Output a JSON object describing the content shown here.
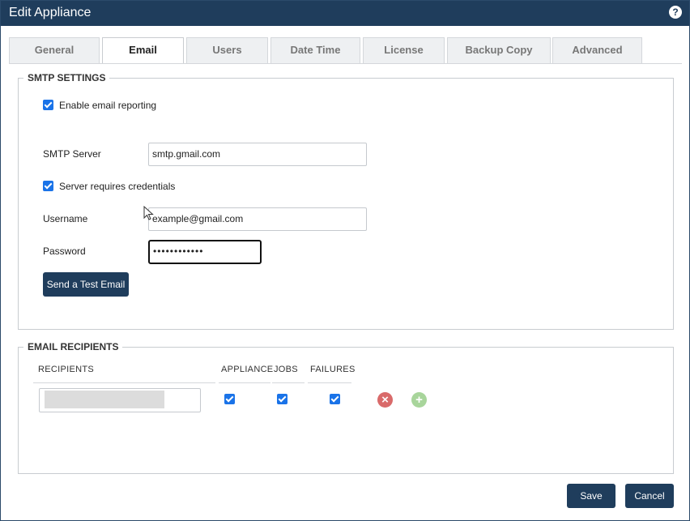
{
  "window": {
    "title": "Edit Appliance",
    "help_glyph": "?"
  },
  "tabs": [
    {
      "label": "General"
    },
    {
      "label": "Email",
      "active": true
    },
    {
      "label": "Users"
    },
    {
      "label": "Date Time"
    },
    {
      "label": "License"
    },
    {
      "label": "Backup Copy"
    },
    {
      "label": "Advanced"
    }
  ],
  "smtp": {
    "legend": "SMTP SETTINGS",
    "enable_reporting_label": "Enable email reporting",
    "enable_reporting_checked": true,
    "server_label": "SMTP Server",
    "server_value": "smtp.gmail.com",
    "requires_credentials_label": "Server requires credentials",
    "requires_credentials_checked": true,
    "username_label": "Username",
    "username_value": "example@gmail.com",
    "password_label": "Password",
    "password_value": "••••••••••••",
    "test_button": "Send a Test Email"
  },
  "recipients": {
    "legend": "EMAIL RECIPIENTS",
    "columns": {
      "recipients": "RECIPIENTS",
      "appliance": "APPLIANCE",
      "jobs": "JOBS",
      "failures": "FAILURES"
    },
    "rows": [
      {
        "appliance": true,
        "jobs": true,
        "failures": true,
        "remove_glyph": "×",
        "add_glyph": "+"
      }
    ]
  },
  "footer": {
    "save": "Save",
    "cancel": "Cancel"
  },
  "colors": {
    "titlebar": "#1f3d5c",
    "button": "#1f3d5c",
    "checkbox": "#1a73e8",
    "remove": "#d96a6a",
    "add": "#a8d59b"
  }
}
